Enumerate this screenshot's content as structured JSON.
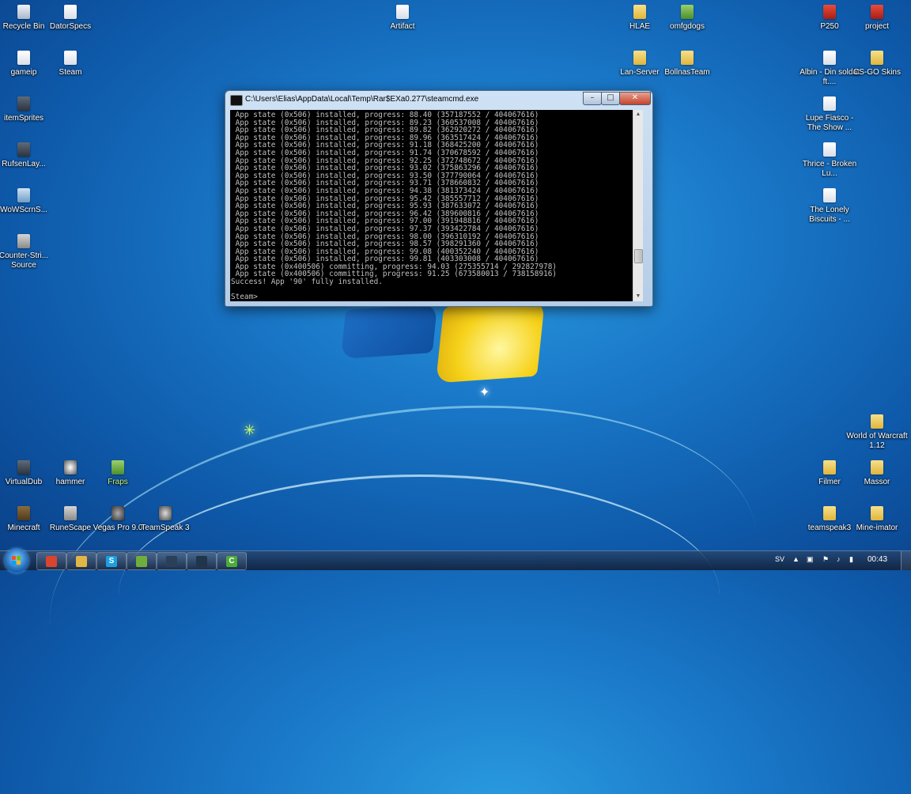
{
  "desktop": {
    "left_icons": [
      {
        "label": "Recycle Bin",
        "icon": "recycle-bin-icon"
      },
      {
        "label": "DatorSpecs",
        "icon": "document-icon"
      },
      {
        "label": "gameip",
        "icon": "document-icon"
      },
      {
        "label": "Steam",
        "icon": "document-icon"
      },
      {
        "label": "itemSprites",
        "icon": "image-icon"
      },
      {
        "label": "RufsenLay...",
        "icon": "image-icon"
      },
      {
        "label": "WoWScrnS...",
        "icon": "image-icon"
      },
      {
        "label": "Counter-Stri... Source",
        "icon": "app-icon"
      },
      {
        "label": "VirtualDub",
        "icon": "app-icon"
      },
      {
        "label": "hammer",
        "icon": "app-icon"
      },
      {
        "label": "Fraps",
        "icon": "app-icon"
      },
      {
        "label": "Minecraft",
        "icon": "app-icon"
      },
      {
        "label": "RuneScape",
        "icon": "app-icon"
      },
      {
        "label": "Vegas Pro 9.0",
        "icon": "app-icon"
      },
      {
        "label": "TeamSpeak 3",
        "icon": "app-icon"
      }
    ],
    "center_icons": [
      {
        "label": "Artifact",
        "icon": "document-icon"
      }
    ],
    "right_icons": [
      {
        "label": "HLAE",
        "icon": "folder-icon"
      },
      {
        "label": "omfgdogs",
        "icon": "image-icon"
      },
      {
        "label": "P250",
        "icon": "image-icon"
      },
      {
        "label": "project",
        "icon": "image-icon"
      },
      {
        "label": "Lan-Server",
        "icon": "folder-icon"
      },
      {
        "label": "BollnasTeam",
        "icon": "folder-icon"
      },
      {
        "label": "Albin - Din soldat ft....",
        "icon": "document-icon"
      },
      {
        "label": "CS-GO Skins",
        "icon": "folder-icon"
      },
      {
        "label": "Lupe Fiasco - The Show ...",
        "icon": "document-icon"
      },
      {
        "label": "Thrice - Broken Lu...",
        "icon": "document-icon"
      },
      {
        "label": "The Lonely Biscuits - ...",
        "icon": "document-icon"
      },
      {
        "label": "World of Warcraft 1.12",
        "icon": "folder-icon"
      },
      {
        "label": "Filmer",
        "icon": "folder-icon"
      },
      {
        "label": "Massor",
        "icon": "folder-icon"
      },
      {
        "label": "teamspeak3",
        "icon": "folder-icon"
      },
      {
        "label": "Mine-imator",
        "icon": "folder-icon"
      }
    ]
  },
  "cmd_window": {
    "title": "C:\\Users\\Elias\\AppData\\Local\\Temp\\Rar$EXa0.277\\steamcmd.exe",
    "minimize_label": "–",
    "maximize_label": "□",
    "close_label": "✕",
    "lines": [
      " App state (0x506) installed, progress: 88.40 (357187552 / 404067616)",
      " App state (0x506) installed, progress: 89.23 (360537008 / 404067616)",
      " App state (0x506) installed, progress: 89.82 (362920272 / 404067616)",
      " App state (0x506) installed, progress: 89.96 (363517424 / 404067616)",
      " App state (0x506) installed, progress: 91.18 (368425200 / 404067616)",
      " App state (0x506) installed, progress: 91.74 (370678592 / 404067616)",
      " App state (0x506) installed, progress: 92.25 (372748672 / 404067616)",
      " App state (0x506) installed, progress: 93.02 (375863296 / 404067616)",
      " App state (0x506) installed, progress: 93.50 (377790064 / 404067616)",
      " App state (0x506) installed, progress: 93.71 (378660832 / 404067616)",
      " App state (0x506) installed, progress: 94.38 (381373424 / 404067616)",
      " App state (0x506) installed, progress: 95.42 (385557712 / 404067616)",
      " App state (0x506) installed, progress: 95.93 (387633072 / 404067616)",
      " App state (0x506) installed, progress: 96.42 (389600816 / 404067616)",
      " App state (0x506) installed, progress: 97.00 (391948816 / 404067616)",
      " App state (0x506) installed, progress: 97.37 (393422784 / 404067616)",
      " App state (0x506) installed, progress: 98.00 (396310192 / 404067616)",
      " App state (0x506) installed, progress: 98.57 (398291360 / 404067616)",
      " App state (0x506) installed, progress: 99.08 (400352240 / 404067616)",
      " App state (0x506) installed, progress: 99.81 (403303008 / 404067616)",
      " App state (0x400506) committing, progress: 94.03 (275355714 / 292827978)",
      " App state (0x400506) committing, progress: 91.25 (673580013 / 738158916)",
      "Success! App '90' fully installed.",
      "",
      "Steam>"
    ]
  },
  "taskbar": {
    "pinned": [
      {
        "name": "taskbar-chrome",
        "icon": "chrome-icon",
        "glyph": "",
        "color": "#d9442f"
      },
      {
        "name": "taskbar-explorer",
        "icon": "folder-icon",
        "glyph": "",
        "color": "#e2b646"
      },
      {
        "name": "taskbar-skype",
        "icon": "skype-icon",
        "glyph": "S",
        "color": "#1aa0e0"
      },
      {
        "name": "taskbar-notepadpp",
        "icon": "notepad-icon",
        "glyph": "",
        "color": "#6fae3c"
      },
      {
        "name": "taskbar-steam",
        "icon": "steam-icon",
        "glyph": "",
        "color": "#2a3f58"
      },
      {
        "name": "taskbar-steamcmd",
        "icon": "steam-icon",
        "glyph": "",
        "color": "#20344a"
      },
      {
        "name": "taskbar-camtasia",
        "icon": "camtasia-icon",
        "glyph": "C",
        "color": "#4cab3a"
      }
    ],
    "language": "SV",
    "clock": "00:43"
  }
}
